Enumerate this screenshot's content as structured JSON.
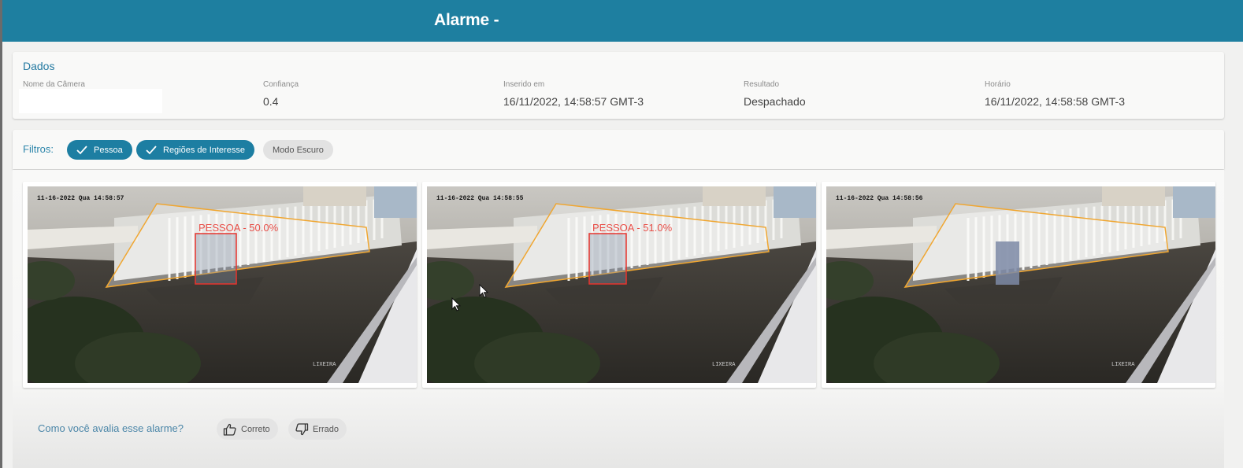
{
  "header": {
    "title": "Alarme -"
  },
  "dados": {
    "heading": "Dados",
    "fields": [
      {
        "label": "Nome da Câmera",
        "value": ""
      },
      {
        "label": "Confiança",
        "value": "0.4"
      },
      {
        "label": "Inserido em",
        "value": "16/11/2022, 14:58:57 GMT-3"
      },
      {
        "label": "Resultado",
        "value": "Despachado"
      },
      {
        "label": "Horário",
        "value": "16/11/2022, 14:58:58 GMT-3"
      }
    ]
  },
  "filters": {
    "label": "Filtros:",
    "chips": [
      {
        "label": "Pessoa",
        "active": true
      },
      {
        "label": "Regiões de Interesse",
        "active": true
      },
      {
        "label": "Modo Escuro",
        "active": false
      }
    ]
  },
  "frames": [
    {
      "timestamp": "11-16-2022 Qua 14:58:57",
      "detection": "PESSOA - 50.0%",
      "watermark": "LIXEIRA"
    },
    {
      "timestamp": "11-16-2022 Qua 14:58:55",
      "detection": "PESSOA - 51.0%",
      "watermark": "LIXEIRA"
    },
    {
      "timestamp": "11-16-2022 Qua 14:58:56",
      "detection": "",
      "watermark": "LIXEIRA"
    }
  ],
  "rating": {
    "question": "Como você avalia esse alarme?",
    "correct_label": "Correto",
    "wrong_label": "Errado"
  },
  "colors": {
    "header": "#1e7fa0",
    "accent": "#2379a1",
    "chip_active": "#1d7ea2",
    "region": "#f0a630",
    "detection_box": "#e8332c"
  },
  "icons": [
    "check-icon",
    "thumbs-up-icon",
    "thumbs-down-icon",
    "mouse-cursor-icon"
  ]
}
